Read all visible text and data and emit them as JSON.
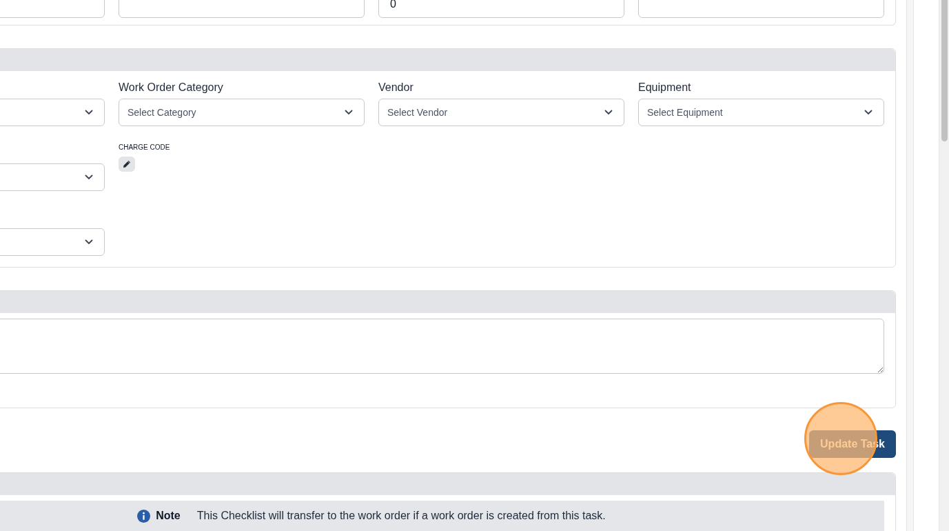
{
  "top_fields": [
    {
      "kind": "input"
    },
    {
      "kind": "input"
    },
    {
      "kind": "input",
      "value": "0"
    },
    {
      "kind": "input"
    }
  ],
  "details": {
    "rows": [
      [
        {
          "kind": "select"
        },
        {
          "kind": "select",
          "label": "Work Order Category",
          "placeholder": "Select Category"
        },
        {
          "kind": "select",
          "label": "Vendor",
          "placeholder": "Select Vendor"
        },
        {
          "kind": "select",
          "label": "Equipment",
          "placeholder": "Select Equipment"
        }
      ],
      [
        {
          "kind": "select"
        },
        {
          "kind": "charge_code",
          "label": "CHARGE CODE"
        }
      ],
      [
        {
          "kind": "select"
        }
      ]
    ]
  },
  "description": {
    "kind": "textarea"
  },
  "update_button": "Update Task",
  "checklist": {
    "note": {
      "label": "Note",
      "text": "This Checklist will transfer to the work order if a work order is created from this task."
    }
  }
}
